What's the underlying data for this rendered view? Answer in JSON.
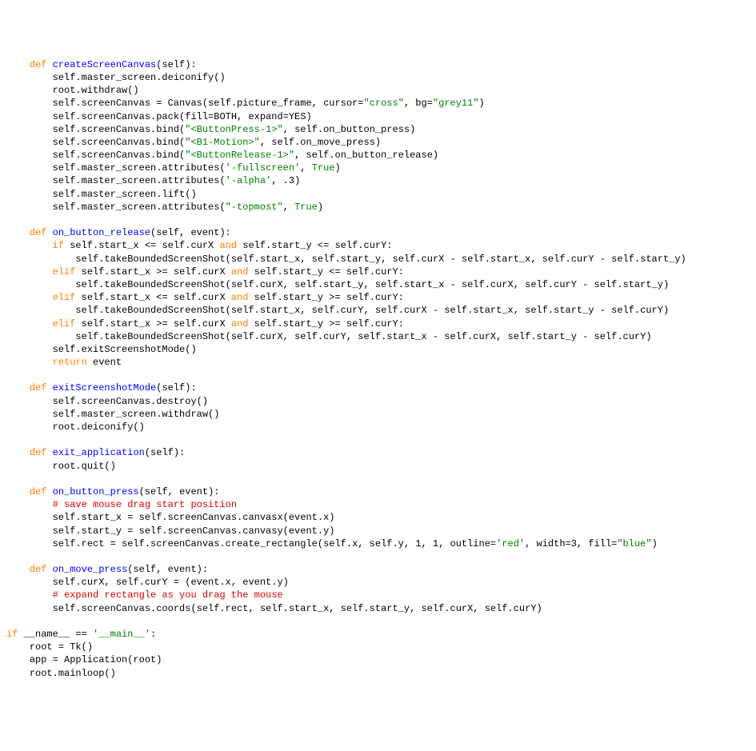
{
  "indent1": "    ",
  "indent2": "        ",
  "indent3": "            ",
  "kw": {
    "def": "def",
    "if": "if",
    "elif": "elif",
    "return": "return",
    "and": "and"
  },
  "fn": {
    "createScreenCanvas": "createScreenCanvas",
    "on_button_release": "on_button_release",
    "exitScreenshotMode": "exitScreenshotMode",
    "exit_application": "exit_application",
    "on_button_press": "on_button_press",
    "on_move_press": "on_move_press"
  },
  "str": {
    "cross": "\"cross\"",
    "grey11": "\"grey11\"",
    "bp1": "\"<ButtonPress-1>\"",
    "b1m": "\"<B1-Motion>\"",
    "br1": "\"<ButtonRelease-1>\"",
    "fullscreen": "'-fullscreen'",
    "alpha": "'-alpha'",
    "topmost": "\"-topmost\"",
    "red": "'red'",
    "blue": "\"blue\"",
    "main": "'__main__'"
  },
  "const": {
    "True": "True"
  },
  "comment": {
    "save": "# save mouse drag start position",
    "expand": "# expand rectangle as you drag the mouse"
  },
  "txt": {
    "self": "(self):",
    "selfEvent": "(self, event):",
    "l1": "self.master_screen.deiconify()",
    "l2": "root.withdraw()",
    "l3a": "self.screenCanvas = Canvas(self.picture_frame, cursor=",
    "l3b": ", bg=",
    "l3c": ")",
    "l4": "self.screenCanvas.pack(fill=BOTH, expand=YES)",
    "l5a": "self.screenCanvas.bind(",
    "l5b": ", self.on_button_press)",
    "l6b": ", self.on_move_press)",
    "l7b": ", self.on_button_release)",
    "l8a": "self.master_screen.attributes(",
    "l8b": ", ",
    "l8c": ")",
    "l9b": ", .3)",
    "l10": "self.master_screen.lift()",
    "cond1a": " self.start_x <= self.curX ",
    "cond1b": " self.start_y <= self.curY:",
    "body1": "self.takeBoundedScreenShot(self.start_x, self.start_y, self.curX - self.start_x, self.curY - self.start_y)",
    "cond2a": " self.start_x >= self.curX ",
    "cond2b": " self.start_y <= self.curY:",
    "body2": "self.takeBoundedScreenShot(self.curX, self.start_y, self.start_x - self.curX, self.curY - self.start_y)",
    "cond3a": " self.start_x <= self.curX ",
    "cond3b": " self.start_y >= self.curY:",
    "body3": "self.takeBoundedScreenShot(self.start_x, self.curY, self.curX - self.start_x, self.start_y - self.curY)",
    "cond4a": " self.start_x >= self.curX ",
    "cond4b": " self.start_y >= self.curY:",
    "body4": "self.takeBoundedScreenShot(self.curX, self.curY, self.start_x - self.curX, self.start_y - self.curY)",
    "exitCall": "self.exitScreenshotMode()",
    "retEvent": " event",
    "ex1": "self.screenCanvas.destroy()",
    "ex2": "self.master_screen.withdraw()",
    "ex3": "root.deiconify()",
    "quit": "root.quit()",
    "bp1": "self.start_x = self.screenCanvas.canvasx(event.x)",
    "bp2": "self.start_y = self.screenCanvas.canvasy(event.y)",
    "bp3a": "self.rect = self.screenCanvas.create_rectangle(self.x, self.y, 1, 1, outline=",
    "bp3b": ", width=3, fill=",
    "bp3c": ")",
    "mv1": "self.curX, self.curY = (event.x, event.y)",
    "mv2": "self.screenCanvas.coords(self.rect, self.start_x, self.start_y, self.curX, self.curY)",
    "mainIf": " __name__ == ",
    "colon": ":",
    "m1": "root = Tk()",
    "m2": "app = Application(root)",
    "m3": "root.mainloop()"
  }
}
